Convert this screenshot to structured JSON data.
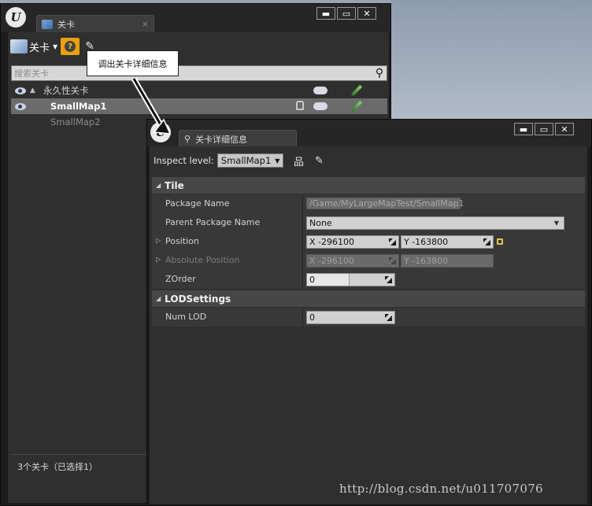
{
  "levels_window": {
    "tab_label": "关卡",
    "close_glyph": "×",
    "window_buttons": [
      "▬",
      "▭",
      "✕"
    ],
    "toolbar": {
      "levels_menu_label": "关卡",
      "dropdown_glyph": "▼",
      "help_glyph": "?",
      "brush_glyph": "✎"
    },
    "tooltip": "调出关卡详细信息",
    "search": {
      "placeholder": "搜索关卡",
      "icon_glyph": "⚲"
    },
    "levels": [
      {
        "name": "永久性关卡",
        "expand_glyph": "▲",
        "visible": true,
        "selected": false
      },
      {
        "name": "SmallMap1",
        "visible": true,
        "selected": true
      },
      {
        "name": "SmallMap2",
        "visible": false,
        "selected": false
      }
    ],
    "status": "3个关卡（已选择1）"
  },
  "details_window": {
    "tab_label": "关卡详细信息",
    "window_buttons": [
      "▬",
      "▭",
      "✕"
    ],
    "inspect_label": "Inspect level:",
    "inspect_value": "SmallMap1",
    "combo_caret": "▼",
    "hierarchy_glyph": "品",
    "brush_glyph": "✎",
    "categories": [
      {
        "name": "Tile",
        "glyph": "◢"
      },
      {
        "name": "LODSettings",
        "glyph": "◢"
      }
    ],
    "properties": {
      "package_name": {
        "label": "Package Name",
        "value": "/Game/MyLargeMapTest/SmallMap1"
      },
      "parent_package_name": {
        "label": "Parent Package Name",
        "value": "None"
      },
      "position": {
        "label": "Position",
        "x": "X  -296100",
        "y": "Y  -163800",
        "expand_glyph": "▷"
      },
      "absolute_position": {
        "label": "Absolute Position",
        "x": "X  -296100",
        "y": "Y  -163800",
        "expand_glyph": "▷"
      },
      "zorder": {
        "label": "ZOrder",
        "value": "0"
      },
      "num_lod": {
        "label": "Num LOD",
        "value": "0"
      }
    }
  },
  "engine_logo_glyph": "U",
  "watermark": "http://blog.csdn.net/u011707076"
}
